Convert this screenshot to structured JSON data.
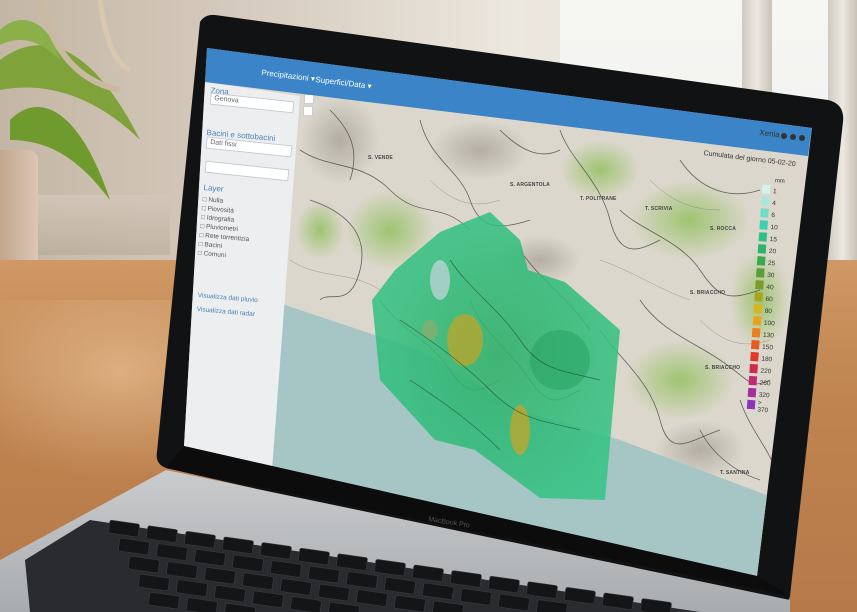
{
  "app": {
    "logo_text": "",
    "menu": [
      {
        "label": "Precipitazioni ▾"
      },
      {
        "label": "Superfici/Data ▾"
      }
    ],
    "user": "Xenia",
    "header_icons": [
      "gear-icon",
      "help-icon",
      "logout-icon"
    ]
  },
  "sidebar": {
    "section_zona": "Zona",
    "select_zona": "Genova",
    "section_bacino": "Bacini e sottobacini",
    "select_bacino": "Dati fissi",
    "date_field": "",
    "section_layers": "Layer",
    "layers": [
      "Nulla",
      "Piovosità",
      "Idrografia",
      "Pluviometri",
      "Rete torrentizia",
      "Bacini",
      "Comuni"
    ],
    "link1": "Visualizza dati pluvio",
    "link2": "Visualizza dati radar"
  },
  "map": {
    "title": "Cumulata del giorno 05-02-20",
    "labels": [
      "S. VENDE",
      "S. ARGENTOLA",
      "T. POLITRANE",
      "T. SCRIVIA",
      "S. ROCCA",
      "S. BRIACCHO",
      "T. SANTINA",
      "S. BRIACCHO"
    ],
    "legend": {
      "unit": "mm",
      "entries": [
        {
          "label": "1",
          "color": "#d6f2ec"
        },
        {
          "label": "4",
          "color": "#a8e8dc"
        },
        {
          "label": "6",
          "color": "#6fdcc6"
        },
        {
          "label": "10",
          "color": "#3dcfae"
        },
        {
          "label": "15",
          "color": "#2fbf8a"
        },
        {
          "label": "20",
          "color": "#2bb46a"
        },
        {
          "label": "25",
          "color": "#3aa84d"
        },
        {
          "label": "30",
          "color": "#5c9e3a"
        },
        {
          "label": "40",
          "color": "#7d9b2a"
        },
        {
          "label": "60",
          "color": "#a9a61e"
        },
        {
          "label": "80",
          "color": "#d7b51a"
        },
        {
          "label": "100",
          "color": "#e9a31a"
        },
        {
          "label": "130",
          "color": "#ec7d1f"
        },
        {
          "label": "150",
          "color": "#e85a24"
        },
        {
          "label": "180",
          "color": "#de3a2c"
        },
        {
          "label": "220",
          "color": "#cf2b4a"
        },
        {
          "label": "260",
          "color": "#c02a78"
        },
        {
          "label": "320",
          "color": "#a72d9e"
        },
        {
          "label": "> 370",
          "color": "#8c34b8"
        }
      ]
    }
  },
  "laptop": {
    "brand": "MacBook Pro"
  }
}
